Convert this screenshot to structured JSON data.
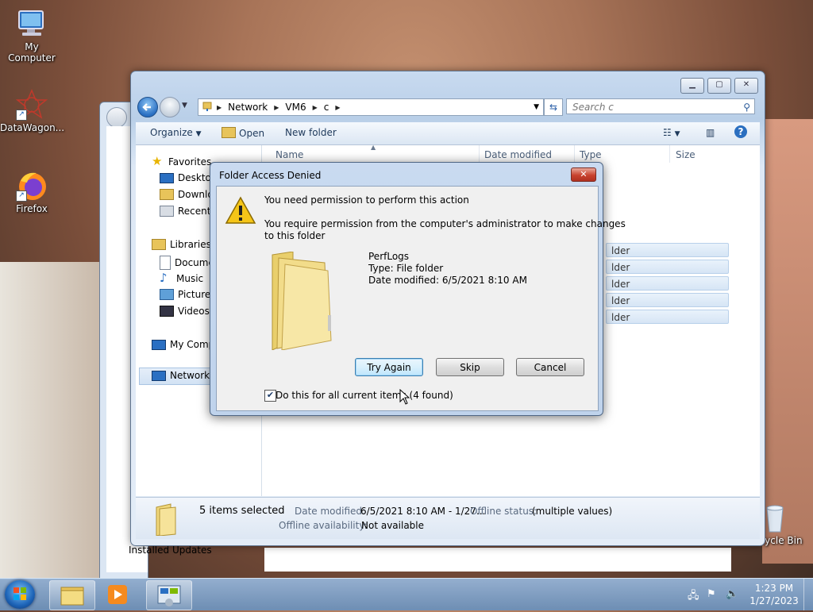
{
  "desktop": {
    "icons": [
      {
        "label": "My Computer"
      },
      {
        "label": "DataWagon..."
      },
      {
        "label": "Firefox"
      },
      {
        "label": "Recycle Bin"
      }
    ],
    "background_label": "Installed Updates"
  },
  "explorer": {
    "breadcrumb": [
      "Network",
      "VM6",
      "c"
    ],
    "search_placeholder": "Search c",
    "toolbar": {
      "organize": "Organize",
      "open": "Open",
      "new_folder": "New folder"
    },
    "nav": {
      "favorites": "Favorites",
      "desktop": "Desktop",
      "downloads": "Downlo",
      "recent": "Recent P",
      "libraries": "Libraries",
      "documents": "Docume",
      "music": "Music",
      "pictures": "Pictures",
      "videos": "Videos",
      "computer": "My Comp",
      "network": "Network"
    },
    "columns": [
      "Name",
      "Date modified",
      "Type",
      "Size"
    ],
    "row_type_fragment": "lder",
    "details": {
      "count": "5 items selected",
      "date_label": "Date modified:",
      "date_value": "6/5/2021 8:10 AM - 1/27...",
      "offline_status_label": "Offline status:",
      "offline_status_value": "(multiple values)",
      "offline_avail_label": "Offline availability:",
      "offline_avail_value": "Not available"
    }
  },
  "dialog": {
    "title": "Folder Access Denied",
    "close": "✕",
    "heading": "You need permission to perform this action",
    "message_line1": "You require permission from the computer's administrator to make changes",
    "message_line2": "to this folder",
    "item_name": "PerfLogs",
    "item_type": "Type: File folder",
    "item_date": "Date modified: 6/5/2021 8:10 AM",
    "buttons": {
      "try_again": "Try Again",
      "skip": "Skip",
      "cancel": "Cancel"
    },
    "checkbox_label": "Do this for all current items (4 found)",
    "checkbox_checked": true
  },
  "taskbar": {
    "time": "1:23 PM",
    "date": "1/27/2023"
  }
}
